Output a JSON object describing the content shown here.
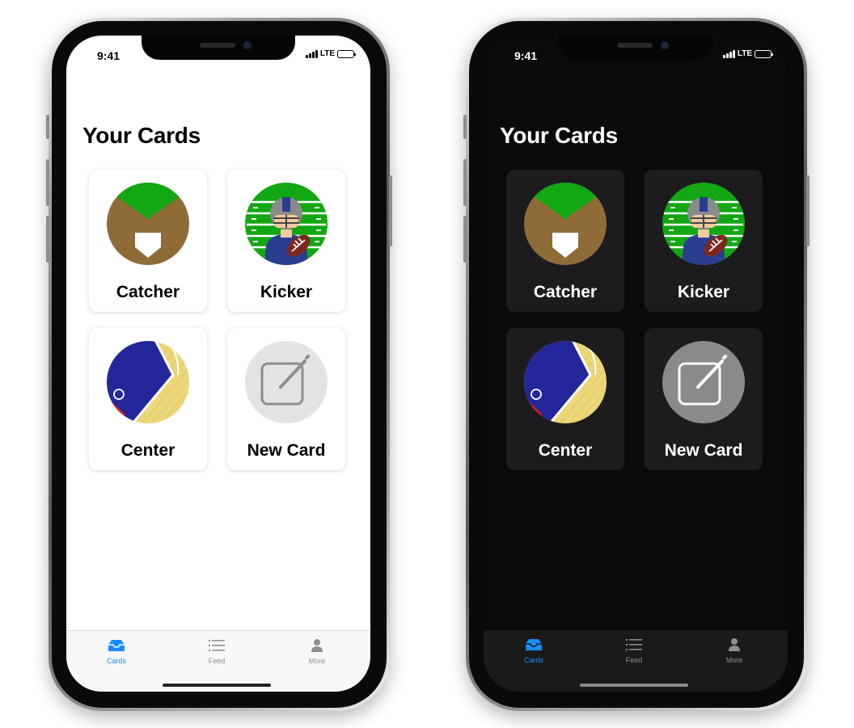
{
  "status": {
    "time": "9:41",
    "network": "LTE"
  },
  "page": {
    "title": "Your Cards"
  },
  "cards": [
    {
      "label": "Catcher",
      "icon": "catcher-icon"
    },
    {
      "label": "Kicker",
      "icon": "kicker-icon"
    },
    {
      "label": "Center",
      "icon": "center-icon"
    },
    {
      "label": "New Card",
      "icon": "compose-icon"
    }
  ],
  "tabs": [
    {
      "label": "Cards",
      "icon": "tray-icon",
      "active": true
    },
    {
      "label": "Feed",
      "icon": "list-icon",
      "active": false
    },
    {
      "label": "More",
      "icon": "person-icon",
      "active": false
    }
  ],
  "colors": {
    "accent": "#1a8cff",
    "field_green": "#13a713",
    "dirt_brown": "#8f6b38",
    "court_blue": "#24279a",
    "court_yellow": "#ecd778"
  }
}
